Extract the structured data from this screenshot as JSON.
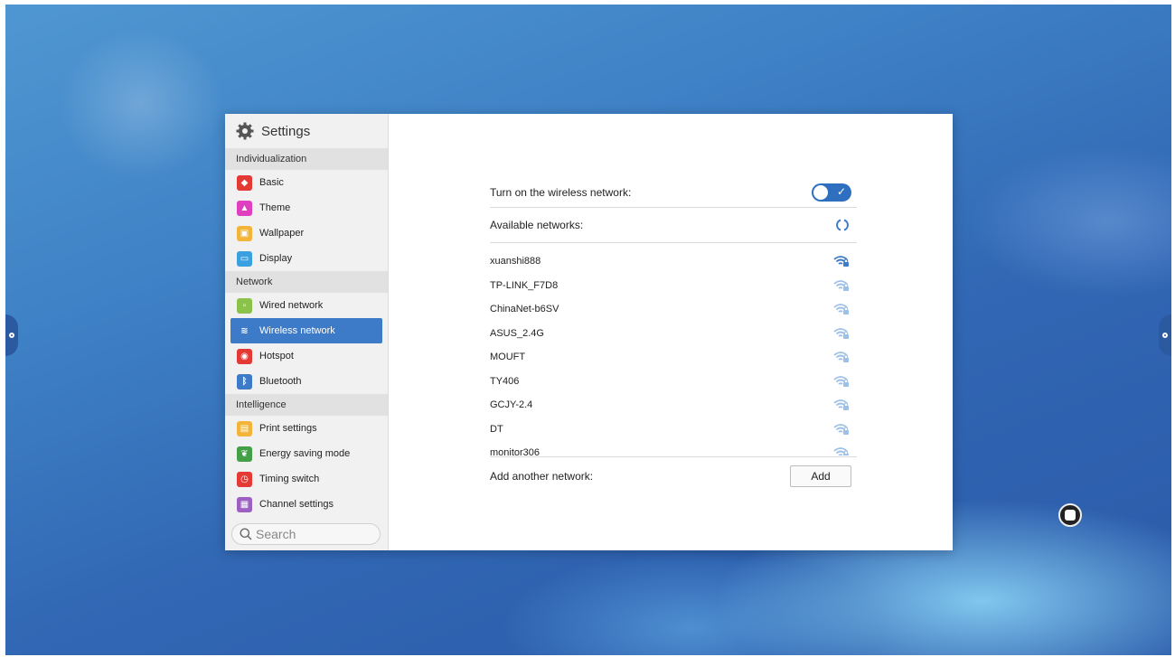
{
  "sidebar": {
    "title": "Settings",
    "groups": [
      {
        "label": "Individualization",
        "items": [
          {
            "label": "Basic",
            "icon": "layers-icon",
            "color": "#e53935"
          },
          {
            "label": "Theme",
            "icon": "shirt-icon",
            "color": "#e040c0"
          },
          {
            "label": "Wallpaper",
            "icon": "image-icon",
            "color": "#f2b53a"
          },
          {
            "label": "Display",
            "icon": "monitor-icon",
            "color": "#3aa0e0"
          }
        ]
      },
      {
        "label": "Network",
        "items": [
          {
            "label": "Wired network",
            "icon": "ethernet-icon",
            "color": "#8bc34a"
          },
          {
            "label": "Wireless network",
            "icon": "wifi-icon",
            "color": "#3d7ac8",
            "active": true
          },
          {
            "label": "Hotspot",
            "icon": "hotspot-icon",
            "color": "#e53935"
          },
          {
            "label": "Bluetooth",
            "icon": "bluetooth-icon",
            "color": "#3d7ac8"
          }
        ]
      },
      {
        "label": "Intelligence",
        "items": [
          {
            "label": "Print settings",
            "icon": "printer-icon",
            "color": "#f2b53a"
          },
          {
            "label": "Energy saving mode",
            "icon": "leaf-icon",
            "color": "#43a047"
          },
          {
            "label": "Timing switch",
            "icon": "clock-icon",
            "color": "#e53935"
          },
          {
            "label": "Channel settings",
            "icon": "channel-icon",
            "color": "#9c5fc2"
          }
        ]
      }
    ],
    "search": {
      "placeholder": "Search"
    }
  },
  "main": {
    "wireless_toggle_label": "Turn on the wireless network:",
    "wireless_enabled": true,
    "available_label": "Available networks:",
    "networks": [
      {
        "ssid": "xuanshi888",
        "connected": true
      },
      {
        "ssid": "TP-LINK_F7D8"
      },
      {
        "ssid": "ChinaNet-b6SV"
      },
      {
        "ssid": "ASUS_2.4G"
      },
      {
        "ssid": "MOUFT"
      },
      {
        "ssid": "TY406"
      },
      {
        "ssid": "GCJY-2.4"
      },
      {
        "ssid": "DT"
      },
      {
        "ssid": "monitor306"
      }
    ],
    "add_label": "Add another network:",
    "add_button": "Add"
  },
  "colors": {
    "accent": "#3d7ac8",
    "wifi_strong": "#3d7ac8",
    "wifi_weak": "#9cc0e6"
  }
}
